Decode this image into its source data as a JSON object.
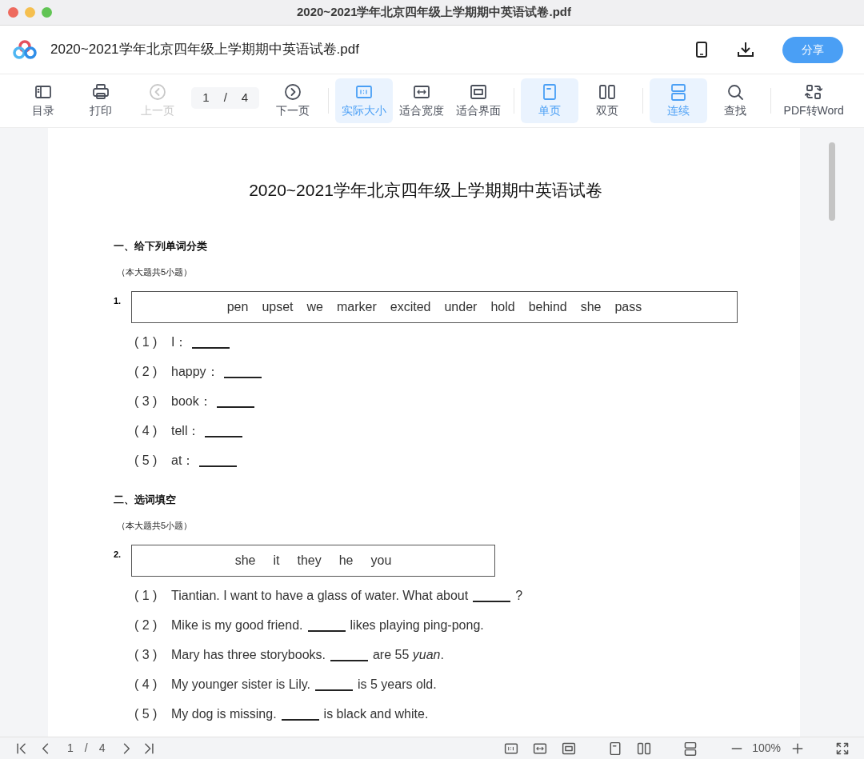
{
  "window": {
    "title": "2020~2021学年北京四年级上学期期中英语试卷.pdf"
  },
  "header": {
    "file_name": "2020~2021学年北京四年级上学期期中英语试卷.pdf",
    "share_button": "分享"
  },
  "toolbar": [
    {
      "kind": "button",
      "label": "目录",
      "selected": false,
      "disabled": false
    },
    {
      "kind": "button",
      "label": "打印",
      "selected": false,
      "disabled": false
    },
    {
      "kind": "button",
      "label": "上一页",
      "selected": false,
      "disabled": true
    },
    {
      "kind": "pager",
      "current": "1",
      "separator": "/",
      "total": "4"
    },
    {
      "kind": "button",
      "label": "下一页",
      "selected": false,
      "disabled": false
    },
    {
      "kind": "divider"
    },
    {
      "kind": "button",
      "label": "实际大小",
      "selected": true,
      "disabled": false
    },
    {
      "kind": "button",
      "label": "适合宽度",
      "selected": false,
      "disabled": false
    },
    {
      "kind": "button",
      "label": "适合界面",
      "selected": false,
      "disabled": false
    },
    {
      "kind": "divider"
    },
    {
      "kind": "button",
      "label": "单页",
      "selected": true,
      "disabled": false
    },
    {
      "kind": "button",
      "label": "双页",
      "selected": false,
      "disabled": false
    },
    {
      "kind": "divider"
    },
    {
      "kind": "button",
      "label": "连续",
      "selected": true,
      "disabled": false
    },
    {
      "kind": "button",
      "label": "查找",
      "selected": false,
      "disabled": false
    },
    {
      "kind": "divider"
    },
    {
      "kind": "button",
      "label": "PDF转Word",
      "selected": false,
      "disabled": false
    }
  ],
  "document": {
    "title": "2020~2021学年北京四年级上学期期中英语试卷",
    "sections": [
      {
        "heading": "一、给下列单词分类",
        "note": "（本大题共5小题）",
        "number": "1.",
        "kind": "label",
        "words": [
          "pen",
          "upset",
          "we",
          "marker",
          "excited",
          "under",
          "hold",
          "behind",
          "she",
          "pass"
        ],
        "items": [
          {
            "num": "( 1 )",
            "before": "I："
          },
          {
            "num": "( 2 )",
            "before": "happy："
          },
          {
            "num": "( 3 )",
            "before": "book："
          },
          {
            "num": "( 4 )",
            "before": "tell："
          },
          {
            "num": "( 5 )",
            "before": "at："
          }
        ]
      },
      {
        "heading": "二、选词填空",
        "note": "（本大题共5小题）",
        "number": "2.",
        "kind": "sentence",
        "words": [
          "she",
          "it",
          "they",
          "he",
          "you"
        ],
        "items": [
          {
            "num": "( 1 )",
            "before": "Tiantian. I want to have a glass of water. What about",
            "after": "?"
          },
          {
            "num": "( 2 )",
            "before": "Mike is my good friend.",
            "after": "likes playing ping-pong."
          },
          {
            "num": "( 3 )",
            "before": "Mary has three storybooks.",
            "after": "are 55 *yuan*."
          },
          {
            "num": "( 4 )",
            "before": "My younger sister is Lily.",
            "after": "is 5 years old."
          },
          {
            "num": "( 5 )",
            "before": "My dog is missing.",
            "after": "is black and white."
          }
        ]
      }
    ]
  },
  "bottom_bar": {
    "current": "1",
    "separator": "/",
    "total": "4",
    "zoom": "100%"
  }
}
